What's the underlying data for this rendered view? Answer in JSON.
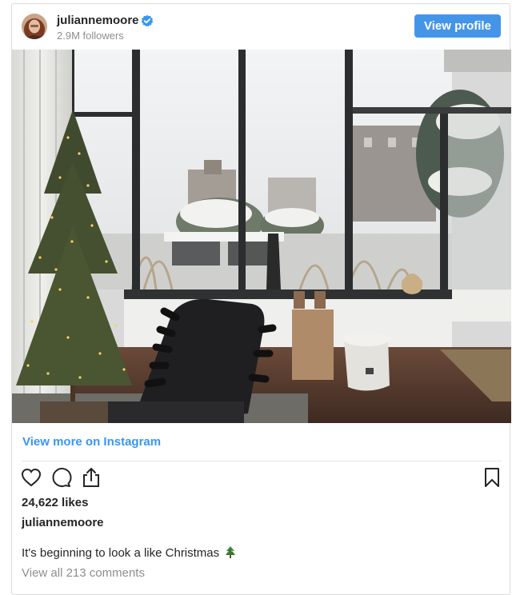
{
  "post": {
    "username": "juliannemoore",
    "followers": "2.9M followers",
    "view_profile_label": "View profile",
    "view_more_label": "View more on Instagram",
    "likes": "24,622 likes",
    "author": "juliannemoore",
    "caption": "It's beginning to look a like Christmas",
    "caption_emoji": "christmas-tree-icon",
    "comments_link": "View all 213 comments"
  },
  "icons": {
    "verified": "verified-badge-icon",
    "like": "heart-icon",
    "comment": "comment-icon",
    "share": "share-icon",
    "save": "bookmark-icon"
  },
  "colors": {
    "button_blue": "#4495e8",
    "link_blue": "#3897f0",
    "muted_text": "#8e8e8e",
    "text": "#262626"
  }
}
